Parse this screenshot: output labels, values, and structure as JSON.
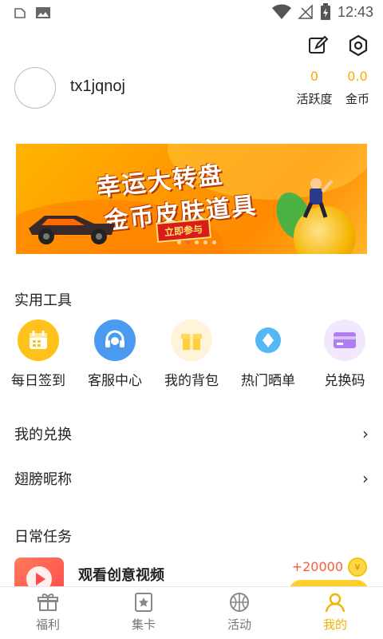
{
  "status_bar": {
    "time": "12:43"
  },
  "profile": {
    "username": "tx1jqnoj",
    "stats": [
      {
        "value": "0",
        "label": "活跃度"
      },
      {
        "value": "0.0",
        "label": "金币"
      }
    ]
  },
  "banner": {
    "line1": "幸运大转盘",
    "line2": "金币皮肤道具",
    "cta": "立即参与"
  },
  "tools": {
    "title": "实用工具",
    "items": [
      {
        "label": "每日签到",
        "icon": "calendar-icon",
        "color": "#ffc21a"
      },
      {
        "label": "客服中心",
        "icon": "headset-icon",
        "color": "#4a9bf0"
      },
      {
        "label": "我的背包",
        "icon": "gift-box-icon",
        "color": "#ffcf3a"
      },
      {
        "label": "热门晒单",
        "icon": "diamond-icon",
        "color": "#55b8f6"
      },
      {
        "label": "兑换码",
        "icon": "card-icon",
        "color": "#b07ef0"
      }
    ]
  },
  "menu": [
    {
      "label": "我的兑换"
    },
    {
      "label": "翅膀昵称"
    }
  ],
  "daily": {
    "title": "日常任务",
    "task": {
      "title": "观看创意视频",
      "reward": "+20000",
      "coin_symbol": "¥"
    }
  },
  "nav": [
    {
      "label": "福利",
      "icon": "gift-icon",
      "active": false
    },
    {
      "label": "集卡",
      "icon": "card-star-icon",
      "active": false
    },
    {
      "label": "活动",
      "icon": "basketball-icon",
      "active": false
    },
    {
      "label": "我的",
      "icon": "profile-icon",
      "active": true
    }
  ],
  "colors": {
    "accent": "#f0b400",
    "reward": "#ff5b3a"
  }
}
